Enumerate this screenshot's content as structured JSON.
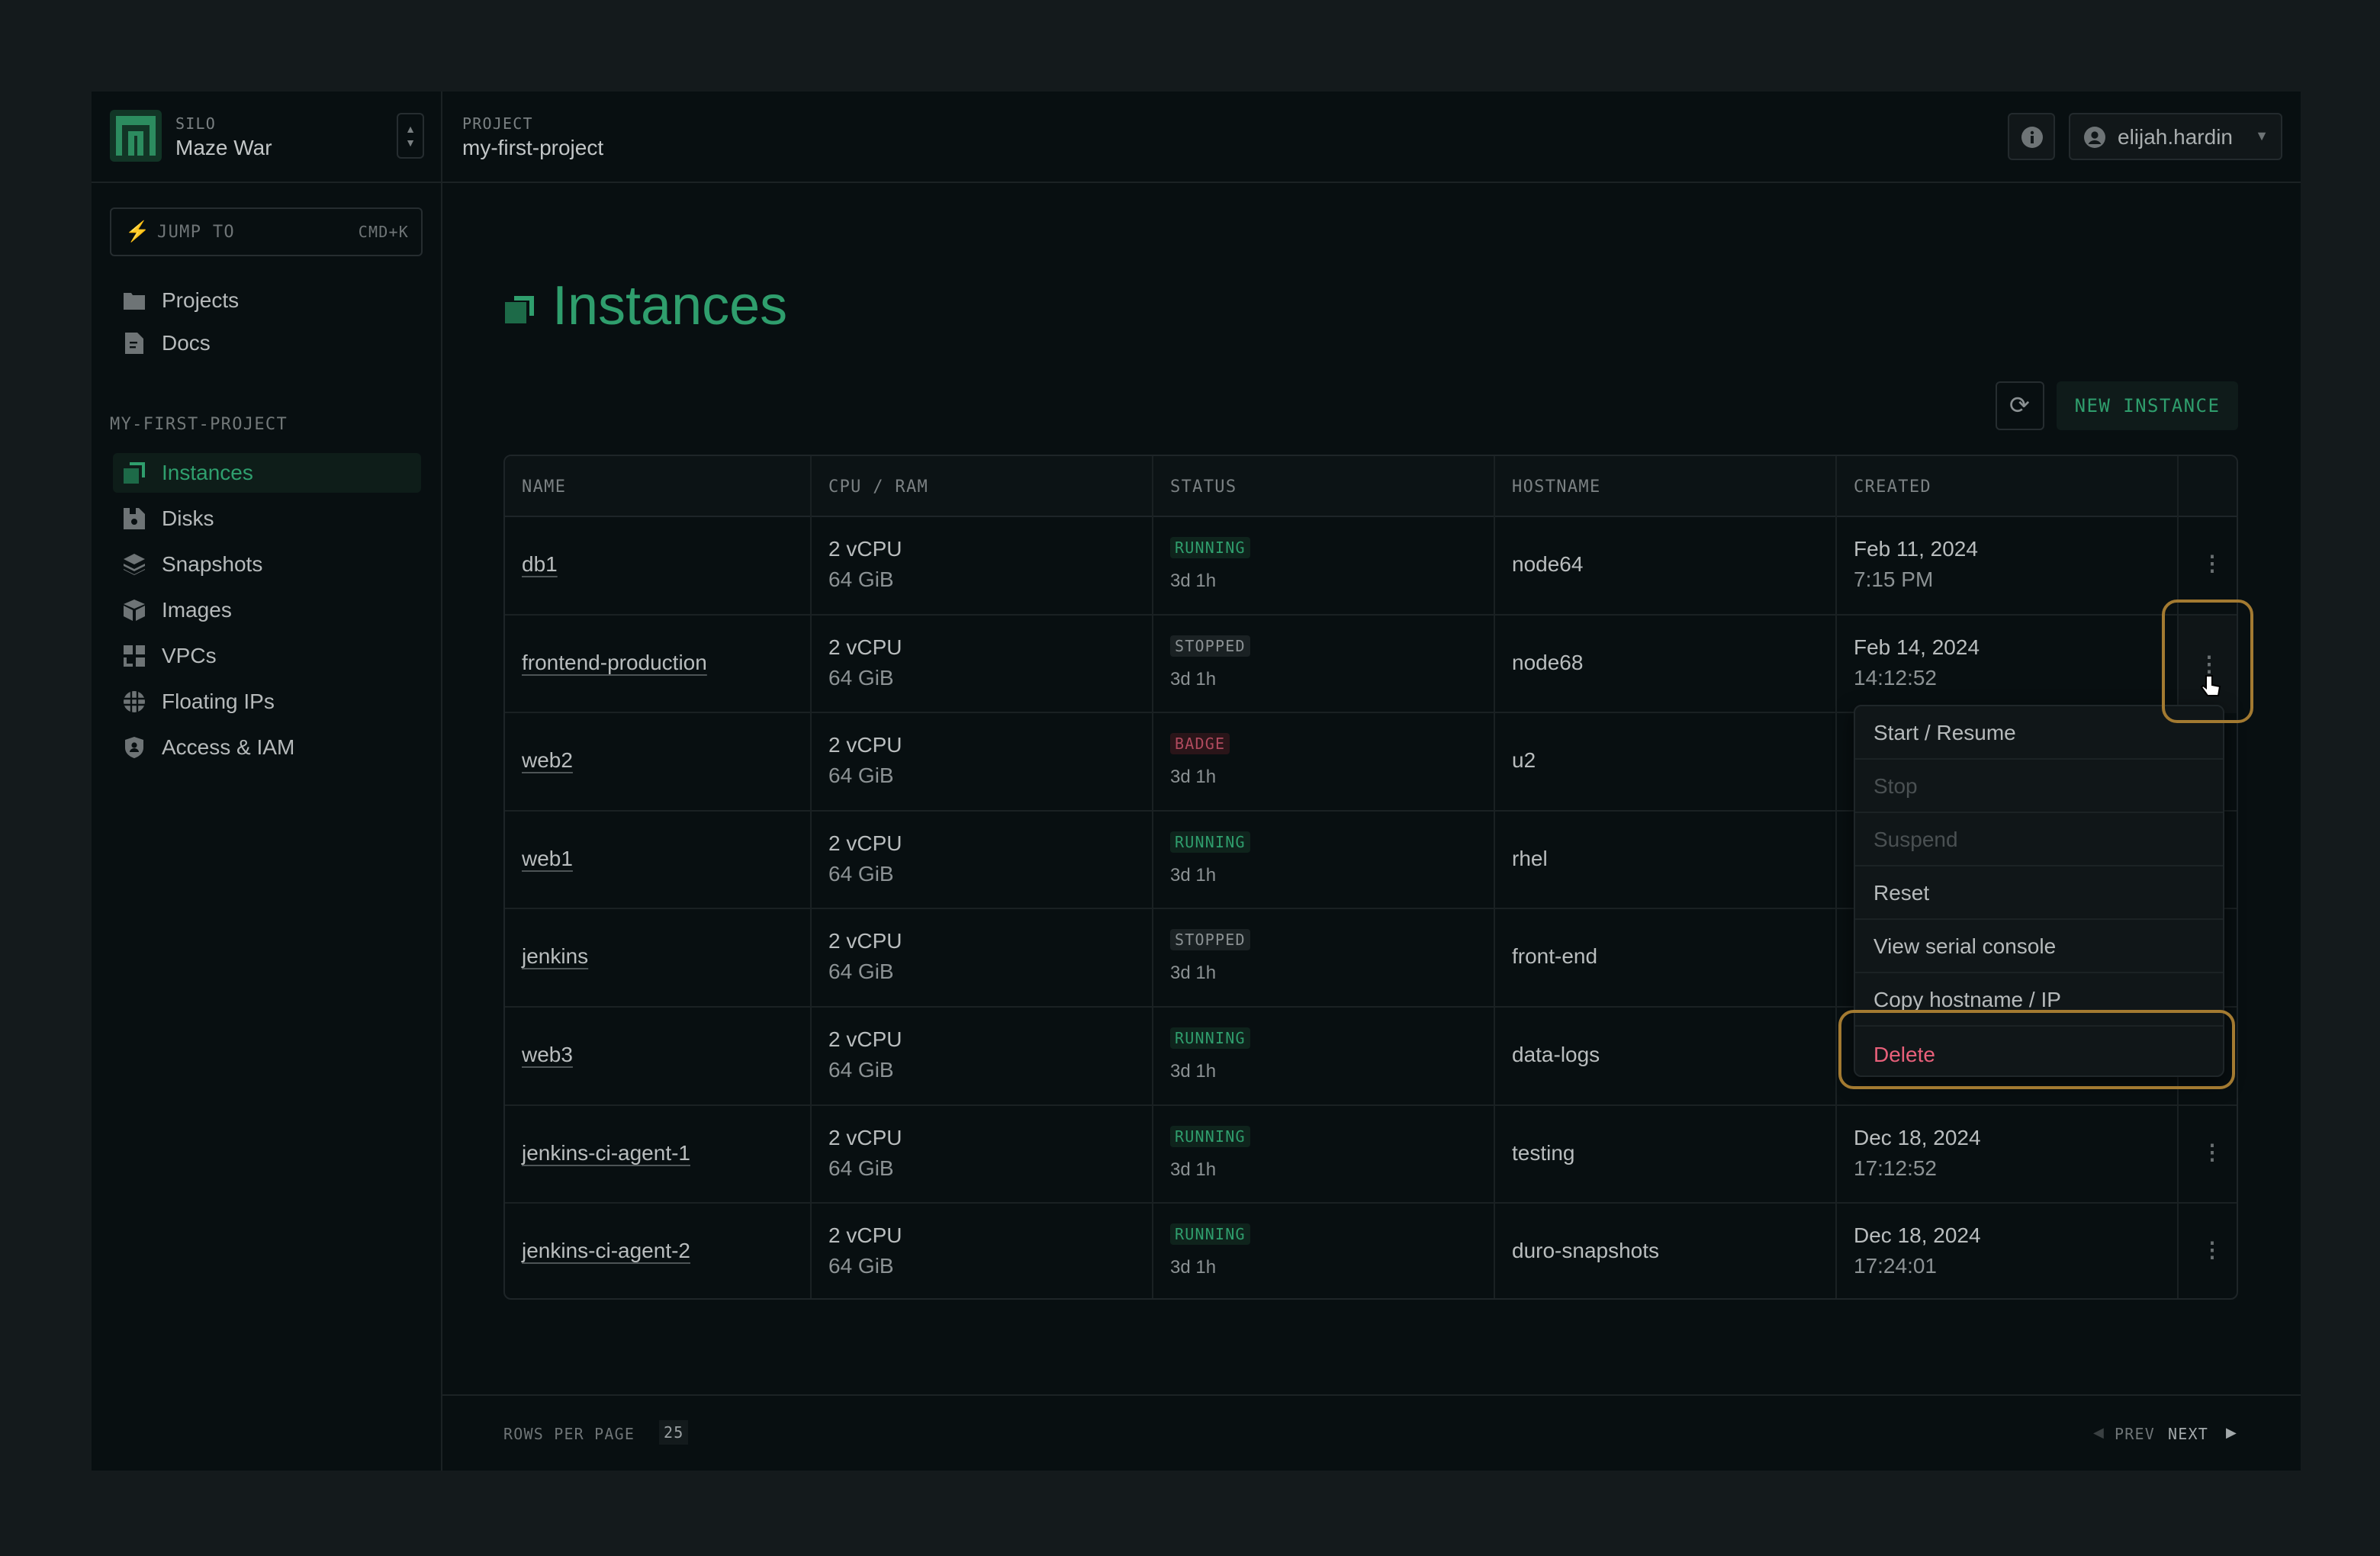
{
  "silo": {
    "label": "SILO",
    "name": "Maze War"
  },
  "project": {
    "label": "PROJECT",
    "name": "my-first-project"
  },
  "header": {
    "user": "elijah.hardin"
  },
  "jump": {
    "label": "JUMP TO",
    "shortcut": "CMD+K"
  },
  "nav_top": [
    {
      "label": "Projects",
      "icon": "folder-icon"
    },
    {
      "label": "Docs",
      "icon": "document-icon"
    }
  ],
  "section_label": "MY-FIRST-PROJECT",
  "nav": [
    {
      "label": "Instances",
      "icon": "instances-icon",
      "active": true
    },
    {
      "label": "Disks",
      "icon": "disk-icon"
    },
    {
      "label": "Snapshots",
      "icon": "layers-icon"
    },
    {
      "label": "Images",
      "icon": "box-icon"
    },
    {
      "label": "VPCs",
      "icon": "network-icon"
    },
    {
      "label": "Floating IPs",
      "icon": "globe-icon"
    },
    {
      "label": "Access & IAM",
      "icon": "shield-icon"
    }
  ],
  "page": {
    "title": "Instances",
    "new_button": "NEW INSTANCE"
  },
  "table": {
    "columns": [
      "NAME",
      "CPU / RAM",
      "STATUS",
      "HOSTNAME",
      "CREATED"
    ],
    "rows": [
      {
        "name": "db1",
        "cpu": "2 vCPU",
        "ram": "64 GiB",
        "status": "RUNNING",
        "uptime": "3d 1h",
        "hostname": "node64",
        "created_date": "Feb 11, 2024",
        "created_time": "7:15 PM"
      },
      {
        "name": "frontend-production",
        "cpu": "2 vCPU",
        "ram": "64 GiB",
        "status": "STOPPED",
        "uptime": "3d 1h",
        "hostname": "node68",
        "created_date": "Feb 14, 2024",
        "created_time": "14:12:52"
      },
      {
        "name": "web2",
        "cpu": "2 vCPU",
        "ram": "64 GiB",
        "status": "BADGE",
        "uptime": "3d 1h",
        "hostname": "u2"
      },
      {
        "name": "web1",
        "cpu": "2 vCPU",
        "ram": "64 GiB",
        "status": "RUNNING",
        "uptime": "3d 1h",
        "hostname": "rhel"
      },
      {
        "name": "jenkins",
        "cpu": "2 vCPU",
        "ram": "64 GiB",
        "status": "STOPPED",
        "uptime": "3d 1h",
        "hostname": "front-end"
      },
      {
        "name": "web3",
        "cpu": "2 vCPU",
        "ram": "64 GiB",
        "status": "RUNNING",
        "uptime": "3d 1h",
        "hostname": "data-logs"
      },
      {
        "name": "jenkins-ci-agent-1",
        "cpu": "2 vCPU",
        "ram": "64 GiB",
        "status": "RUNNING",
        "uptime": "3d 1h",
        "hostname": "testing",
        "created_date": "Dec 18, 2024",
        "created_time": "17:12:52"
      },
      {
        "name": "jenkins-ci-agent-2",
        "cpu": "2 vCPU",
        "ram": "64 GiB",
        "status": "RUNNING",
        "uptime": "3d 1h",
        "hostname": "duro-snapshots",
        "created_date": "Dec 18, 2024",
        "created_time": "17:24:01"
      }
    ]
  },
  "menu": [
    {
      "label": "Start / Resume",
      "state": "enabled"
    },
    {
      "label": "Stop",
      "state": "disabled"
    },
    {
      "label": "Suspend",
      "state": "disabled"
    },
    {
      "label": "Reset",
      "state": "enabled"
    },
    {
      "label": "View serial console",
      "state": "enabled"
    },
    {
      "label": "Copy hostname / IP",
      "state": "enabled"
    },
    {
      "label": "Delete",
      "state": "destructive"
    }
  ],
  "footer": {
    "rows_label": "ROWS PER PAGE",
    "rows_value": "25",
    "prev": "PREV",
    "next": "NEXT"
  },
  "colors": {
    "accent": "#2f9e6d",
    "destructive": "#e8607a",
    "highlight": "#a37a31",
    "background": "#080f11"
  }
}
